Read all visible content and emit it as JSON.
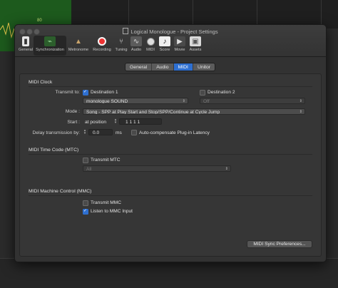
{
  "background": {
    "marker": "80"
  },
  "window": {
    "title": "Logical Monologue - Project Settings",
    "toolbar": [
      {
        "label": "General",
        "icon": "switch-icon"
      },
      {
        "label": "Synchronization",
        "icon": "sync-icon"
      },
      {
        "label": "Metronome",
        "icon": "metronome-icon"
      },
      {
        "label": "Recording",
        "icon": "record-icon"
      },
      {
        "label": "Tuning",
        "icon": "tuning-fork-icon"
      },
      {
        "label": "Audio",
        "icon": "waveform-icon"
      },
      {
        "label": "MIDI",
        "icon": "midi-port-icon"
      },
      {
        "label": "Score",
        "icon": "score-note-icon"
      },
      {
        "label": "Movie",
        "icon": "film-icon"
      },
      {
        "label": "Assets",
        "icon": "box-icon"
      }
    ],
    "selected_tool": "Synchronization"
  },
  "tabs": [
    "General",
    "Audio",
    "MIDI",
    "Unitor"
  ],
  "active_tab": "MIDI",
  "midi_clock": {
    "heading": "MIDI Clock",
    "transmit_to_label": "Transmit to:",
    "destination1": {
      "label": "Destination 1",
      "checked": true,
      "port": "monologue SOUND"
    },
    "destination2": {
      "label": "Destination 2",
      "checked": false,
      "port": "Off"
    },
    "mode_label": "Mode :",
    "mode_value": "Song - SPP at Play Start and Stop/SPP/Continue at Cycle Jump",
    "start_label": "Start :",
    "start_at": "at position",
    "start_position": "1  1  1      1",
    "delay_label": "Delay transmission by:",
    "delay_value": "0.0",
    "delay_unit": "ms",
    "auto_compensate_label": "Auto-compensate Plug-in Latency",
    "auto_compensate_checked": false
  },
  "mtc": {
    "heading": "MIDI Time Code (MTC)",
    "transmit_label": "Transmit MTC",
    "transmit_checked": false,
    "port_value": "All"
  },
  "mmc": {
    "heading": "MIDI Machine Control (MMC)",
    "transmit_label": "Transmit MMC",
    "transmit_checked": false,
    "listen_label": "Listen to MMC Input",
    "listen_checked": true
  },
  "sync_prefs_button": "MIDI Sync Preferences...",
  "colors": {
    "accent": "#2e6fd0",
    "window_bg": "#323232",
    "pane_bg": "#363636",
    "track_green": "#1d5a1d"
  }
}
